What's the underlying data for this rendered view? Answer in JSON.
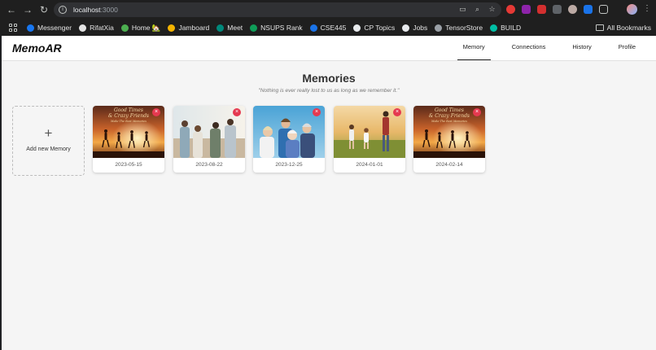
{
  "browser": {
    "url_host": "localhost",
    "url_port": ":3000",
    "bookmarks": [
      {
        "label": "Messenger",
        "color": "#1877f2"
      },
      {
        "label": "RifatXia",
        "color": "#e3e3e3"
      },
      {
        "label": "Home 🏡",
        "color": "#4caf50"
      },
      {
        "label": "Jamboard",
        "color": "#f4b400"
      },
      {
        "label": "Meet",
        "color": "#00897b"
      },
      {
        "label": "NSUPS Rank",
        "color": "#0f9d58"
      },
      {
        "label": "CSE445",
        "color": "#1a73e8"
      },
      {
        "label": "CP Topics",
        "color": "#e8eaed"
      },
      {
        "label": "Jobs",
        "color": "#e8eaed"
      },
      {
        "label": "TensorStore",
        "color": "#9aa0a6"
      },
      {
        "label": "BUILD",
        "color": "#00bfa5"
      }
    ],
    "all_bookmarks": "All Bookmarks"
  },
  "app": {
    "brand": "MemoAR",
    "nav": [
      {
        "label": "Memory",
        "active": true
      },
      {
        "label": "Connections",
        "active": false
      },
      {
        "label": "History",
        "active": false
      },
      {
        "label": "Profile",
        "active": false
      }
    ],
    "title": "Memories",
    "quote": "\"Nothing is ever really lost to us as long as we remember it.\"",
    "add_label": "Add new Memory",
    "add_icon": "+",
    "delete_icon": "×"
  },
  "memories": [
    {
      "date": "2023-05-15",
      "image": "sunset-friends",
      "caption": [
        "Good Times",
        "& Crazy Friends",
        "Make The Best Memories"
      ]
    },
    {
      "date": "2023-08-22",
      "image": "friends-beach"
    },
    {
      "date": "2023-12-25",
      "image": "family-selfie"
    },
    {
      "date": "2024-01-01",
      "image": "family-park"
    },
    {
      "date": "2024-02-14",
      "image": "sunset-friends",
      "caption": [
        "Good Times",
        "& Crazy Friends",
        "Make The Best Memories"
      ]
    }
  ]
}
